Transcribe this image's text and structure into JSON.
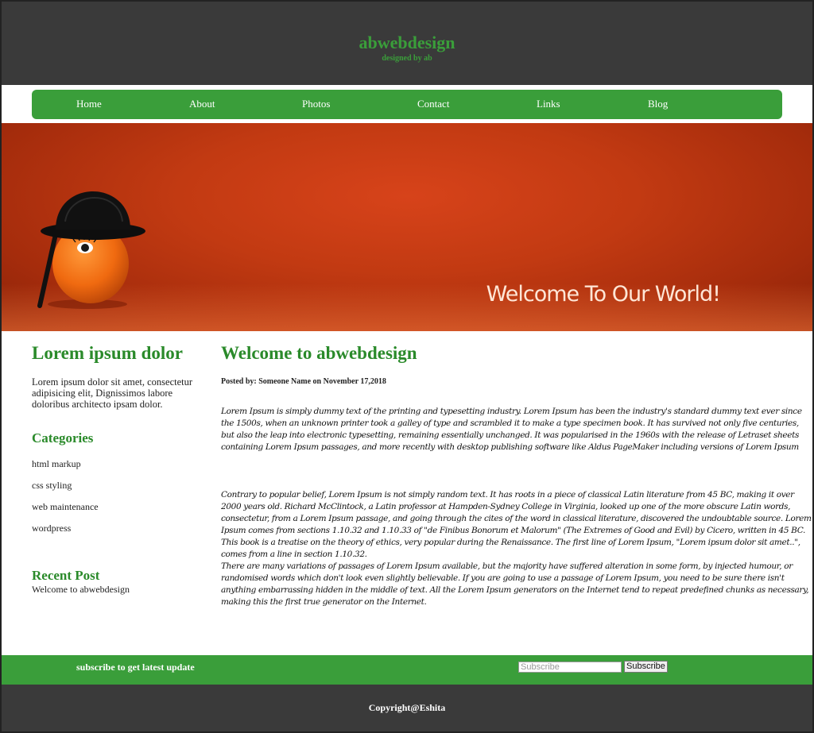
{
  "header": {
    "title": "abwebdesign",
    "subtitle": "designed by ab"
  },
  "nav": {
    "items": [
      {
        "label": "Home"
      },
      {
        "label": "About"
      },
      {
        "label": "Photos"
      },
      {
        "label": "Contact"
      },
      {
        "label": "Links"
      },
      {
        "label": "Blog"
      }
    ]
  },
  "banner": {
    "text": "Welcome To Our World!"
  },
  "sidebar": {
    "heading": "Lorem ipsum dolor",
    "intro": "Lorem ipsum dolor sit amet, consectetur adipisicing elit, Dignissimos labore doloribus architecto ipsam dolor.",
    "categories_heading": "Categories",
    "categories": [
      {
        "label": "html markup"
      },
      {
        "label": "css styling"
      },
      {
        "label": "web maintenance"
      },
      {
        "label": "wordpress"
      }
    ],
    "recent_heading": "Recent Post",
    "recent_post": "Welcome to abwebdesign"
  },
  "main": {
    "heading": "Welcome to abwebdesign",
    "posted": "Posted by: Someone Name on November 17,2018",
    "paragraph1": "Lorem Ipsum is simply dummy text of the printing and typesetting industry. Lorem Ipsum has been the industry's standard dummy text ever since the 1500s, when an unknown printer took a galley of type and scrambled it to make a type specimen book. It has survived not only five centuries, but also the leap into electronic typesetting, remaining essentially unchanged. It was popularised in the 1960s with the release of Letraset sheets containing Lorem Ipsum passages, and more recently with desktop publishing software like Aldus PageMaker including versions of Lorem Ipsum",
    "paragraph2": "Contrary to popular belief, Lorem Ipsum is not simply random text. It has roots in a piece of classical Latin literature from 45 BC, making it over 2000 years old. Richard McClintock, a Latin professor at Hampden-Sydney College in Virginia, looked up one of the more obscure Latin words, consectetur, from a Lorem Ipsum passage, and going through the cites of the word in classical literature, discovered the undoubtable source. Lorem Ipsum comes from sections 1.10.32 and 1.10.33 of \"de Finibus Bonorum et Malorum\" (The Extremes of Good and Evil) by Cicero, written in 45 BC. This book is a treatise on the theory of ethics, very popular during the Renaissance. The first line of Lorem Ipsum, \"Lorem ipsum dolor sit amet..\", comes from a line in section 1.10.32.",
    "paragraph3": "There are many variations of passages of Lorem Ipsum available, but the majority have suffered alteration in some form, by injected humour, or randomised words which don't look even slightly believable. If you are going to use a passage of Lorem Ipsum, you need to be sure there isn't anything embarrassing hidden in the middle of text. All the Lorem Ipsum generators on the Internet tend to repeat predefined chunks as necessary, making this the first true generator on the Internet."
  },
  "subscribe": {
    "text": "subscribe to get latest update",
    "placeholder": "Subscribe",
    "button": "Subscribe"
  },
  "footer": {
    "copyright": "Copyright@Eshita"
  },
  "colors": {
    "accent": "#3a9e3a",
    "heading": "#2a8a2a",
    "dark": "#3a3a3a",
    "banner": "#c23a12"
  }
}
